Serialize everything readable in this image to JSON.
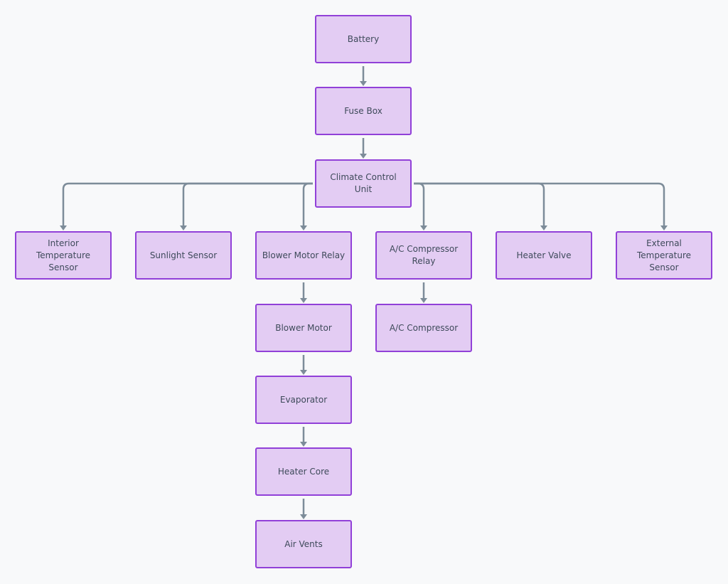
{
  "diagram": {
    "type": "flowchart",
    "direction": "top-down",
    "colors": {
      "background": "#f8f9fa",
      "node_fill": "#e3ccf3",
      "node_border": "#9140d8",
      "node_text": "#3e4a5a",
      "edge": "#7d8c99"
    },
    "nodes": [
      {
        "id": "battery",
        "label": "Battery"
      },
      {
        "id": "fuse_box",
        "label": "Fuse Box"
      },
      {
        "id": "climate_control_unit",
        "label": "Climate Control Unit"
      },
      {
        "id": "interior_temp_sensor",
        "label": "Interior Temperature Sensor"
      },
      {
        "id": "sunlight_sensor",
        "label": "Sunlight Sensor"
      },
      {
        "id": "blower_motor_relay",
        "label": "Blower Motor Relay"
      },
      {
        "id": "ac_compressor_relay",
        "label": "A/C Compressor Relay"
      },
      {
        "id": "heater_valve",
        "label": "Heater Valve"
      },
      {
        "id": "external_temp_sensor",
        "label": "External Temperature Sensor"
      },
      {
        "id": "blower_motor",
        "label": "Blower Motor"
      },
      {
        "id": "ac_compressor",
        "label": "A/C Compressor"
      },
      {
        "id": "evaporator",
        "label": "Evaporator"
      },
      {
        "id": "heater_core",
        "label": "Heater Core"
      },
      {
        "id": "air_vents",
        "label": "Air Vents"
      }
    ],
    "edges": [
      {
        "from": "battery",
        "to": "fuse_box"
      },
      {
        "from": "fuse_box",
        "to": "climate_control_unit"
      },
      {
        "from": "climate_control_unit",
        "to": "interior_temp_sensor"
      },
      {
        "from": "climate_control_unit",
        "to": "sunlight_sensor"
      },
      {
        "from": "climate_control_unit",
        "to": "blower_motor_relay"
      },
      {
        "from": "climate_control_unit",
        "to": "ac_compressor_relay"
      },
      {
        "from": "climate_control_unit",
        "to": "heater_valve"
      },
      {
        "from": "climate_control_unit",
        "to": "external_temp_sensor"
      },
      {
        "from": "blower_motor_relay",
        "to": "blower_motor"
      },
      {
        "from": "ac_compressor_relay",
        "to": "ac_compressor"
      },
      {
        "from": "blower_motor",
        "to": "evaporator"
      },
      {
        "from": "evaporator",
        "to": "heater_core"
      },
      {
        "from": "heater_core",
        "to": "air_vents"
      }
    ]
  }
}
